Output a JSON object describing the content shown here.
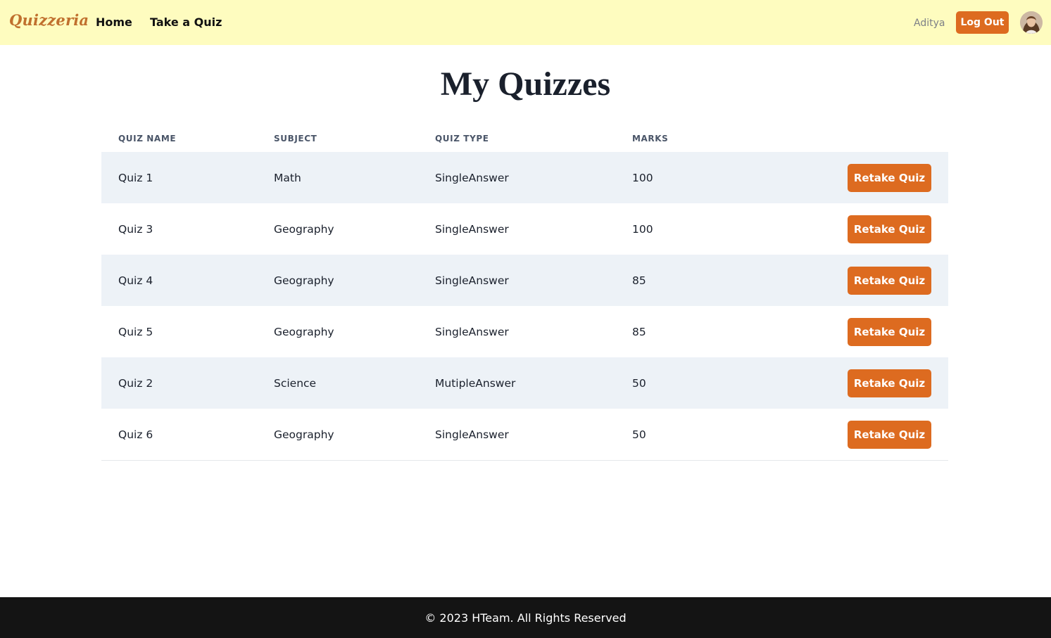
{
  "nav": {
    "brand": "Quizzeria",
    "links": [
      {
        "label": "Home"
      },
      {
        "label": "Take a Quiz"
      }
    ],
    "username": "Aditya",
    "logout_label": "Log Out"
  },
  "main": {
    "title": "My Quizzes",
    "columns": [
      "QUIZ NAME",
      "SUBJECT",
      "QUIZ TYPE",
      "MARKS"
    ],
    "rows": [
      {
        "name": "Quiz 1",
        "subject": "Math",
        "type": "SingleAnswer",
        "marks": "100",
        "action": "Retake Quiz"
      },
      {
        "name": "Quiz 3",
        "subject": "Geography",
        "type": "SingleAnswer",
        "marks": "100",
        "action": "Retake Quiz"
      },
      {
        "name": "Quiz 4",
        "subject": "Geography",
        "type": "SingleAnswer",
        "marks": "85",
        "action": "Retake Quiz"
      },
      {
        "name": "Quiz 5",
        "subject": "Geography",
        "type": "SingleAnswer",
        "marks": "85",
        "action": "Retake Quiz"
      },
      {
        "name": "Quiz 2",
        "subject": "Science",
        "type": "MutipleAnswer",
        "marks": "50",
        "action": "Retake Quiz"
      },
      {
        "name": "Quiz 6",
        "subject": "Geography",
        "type": "SingleAnswer",
        "marks": "50",
        "action": "Retake Quiz"
      }
    ]
  },
  "footer": {
    "text": "© 2023 HTeam. All Rights Reserved"
  },
  "colors": {
    "navbar_bg": "#fefcbf",
    "accent": "#dd6b20",
    "brand": "#c0702e",
    "row_alt_bg": "#edf2f7",
    "footer_bg": "#141414"
  },
  "icons": {
    "avatar": "user-avatar-photo"
  }
}
